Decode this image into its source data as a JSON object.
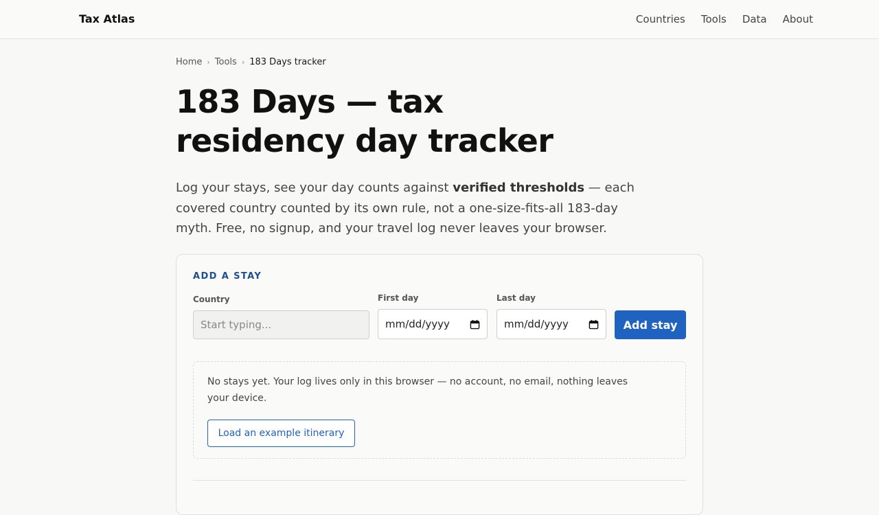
{
  "header": {
    "brand": "Tax Atlas",
    "nav": [
      "Countries",
      "Tools",
      "Data",
      "About"
    ]
  },
  "breadcrumb": {
    "items": [
      "Home",
      "Tools",
      "183 Days tracker"
    ],
    "separator": "›"
  },
  "page": {
    "title": "183 Days — tax residency day tracker",
    "lede_before": "Log your stays, see your day counts against ",
    "lede_bold": "verified thresholds",
    "lede_after": " — each covered country counted by its own rule, not a one-size-fits-all 183-day myth. Free, no signup, and your travel log never leaves your browser."
  },
  "add_stay": {
    "title": "ADD A STAY",
    "country_label": "Country",
    "country_placeholder": "Start typing...",
    "first_day_label": "First day",
    "first_day_value": "mm/dd/yyyy",
    "last_day_label": "Last day",
    "last_day_value": "mm/dd/yyyy",
    "submit_label": "Add stay"
  },
  "empty_state": {
    "text": "No stays yet. Your log lives only in this browser — no account, no email, nothing leaves your device.",
    "example_button": "Load an example itinerary"
  },
  "colors": {
    "accent": "#1f62c0",
    "section_title": "#1d4f91",
    "background": "#f8f8f6"
  },
  "icons": [
    "calendar-icon"
  ]
}
